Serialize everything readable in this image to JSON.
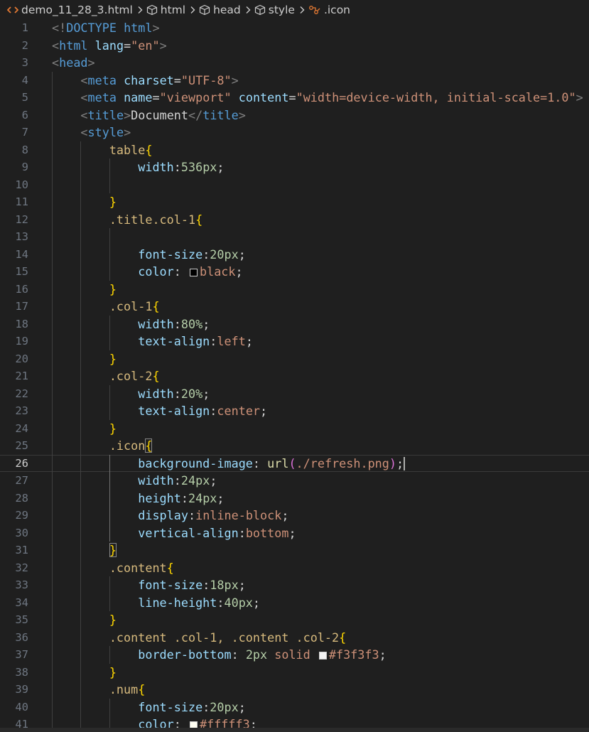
{
  "breadcrumb": {
    "file": "demo_11_28_3.html",
    "items": [
      "html",
      "head",
      "style",
      ".icon"
    ]
  },
  "colors": {
    "background": "#1f1f1f",
    "tag": "#569cd6",
    "attribute": "#9cdcfe",
    "string": "#ce9178",
    "selector": "#d7ba7d",
    "brace": "#ffd700",
    "number": "#b5cea8",
    "function": "#dcdcaa"
  },
  "editor": {
    "current_line": 26,
    "lines": [
      {
        "n": "1",
        "text": "<!DOCTYPE html>"
      },
      {
        "n": "2",
        "text": "<html lang=\"en\">"
      },
      {
        "n": "3",
        "text": "<head>"
      },
      {
        "n": "4",
        "text": "    <meta charset=\"UTF-8\">"
      },
      {
        "n": "5",
        "text": "    <meta name=\"viewport\" content=\"width=device-width, initial-scale=1.0\">"
      },
      {
        "n": "6",
        "text": "    <title>Document</title>"
      },
      {
        "n": "7",
        "text": "    <style>"
      },
      {
        "n": "8",
        "text": "        table{"
      },
      {
        "n": "9",
        "text": "            width:536px;"
      },
      {
        "n": "10",
        "text": ""
      },
      {
        "n": "11",
        "text": "        }"
      },
      {
        "n": "12",
        "text": "        .title.col-1{"
      },
      {
        "n": "13",
        "text": ""
      },
      {
        "n": "14",
        "text": "            font-size:20px;"
      },
      {
        "n": "15",
        "text": "            color: black;"
      },
      {
        "n": "16",
        "text": "        }"
      },
      {
        "n": "17",
        "text": "        .col-1{"
      },
      {
        "n": "18",
        "text": "            width:80%;"
      },
      {
        "n": "19",
        "text": "            text-align:left;"
      },
      {
        "n": "20",
        "text": "        }"
      },
      {
        "n": "21",
        "text": "        .col-2{"
      },
      {
        "n": "22",
        "text": "            width:20%;"
      },
      {
        "n": "23",
        "text": "            text-align:center;"
      },
      {
        "n": "24",
        "text": "        }"
      },
      {
        "n": "25",
        "text": "        .icon{"
      },
      {
        "n": "26",
        "text": "            background-image: url(./refresh.png);"
      },
      {
        "n": "27",
        "text": "            width:24px;"
      },
      {
        "n": "28",
        "text": "            height:24px;"
      },
      {
        "n": "29",
        "text": "            display:inline-block;"
      },
      {
        "n": "30",
        "text": "            vertical-align:bottom;"
      },
      {
        "n": "31",
        "text": "        }"
      },
      {
        "n": "32",
        "text": "        .content{"
      },
      {
        "n": "33",
        "text": "            font-size:18px;"
      },
      {
        "n": "34",
        "text": "            line-height:40px;"
      },
      {
        "n": "35",
        "text": "        }"
      },
      {
        "n": "36",
        "text": "        .content .col-1, .content .col-2{"
      },
      {
        "n": "37",
        "text": "            border-bottom: 2px solid #f3f3f3;"
      },
      {
        "n": "38",
        "text": "        }"
      },
      {
        "n": "39",
        "text": "        .num{"
      },
      {
        "n": "40",
        "text": "            font-size:20px;"
      },
      {
        "n": "41",
        "text": "            color: #fffff3;"
      }
    ]
  }
}
